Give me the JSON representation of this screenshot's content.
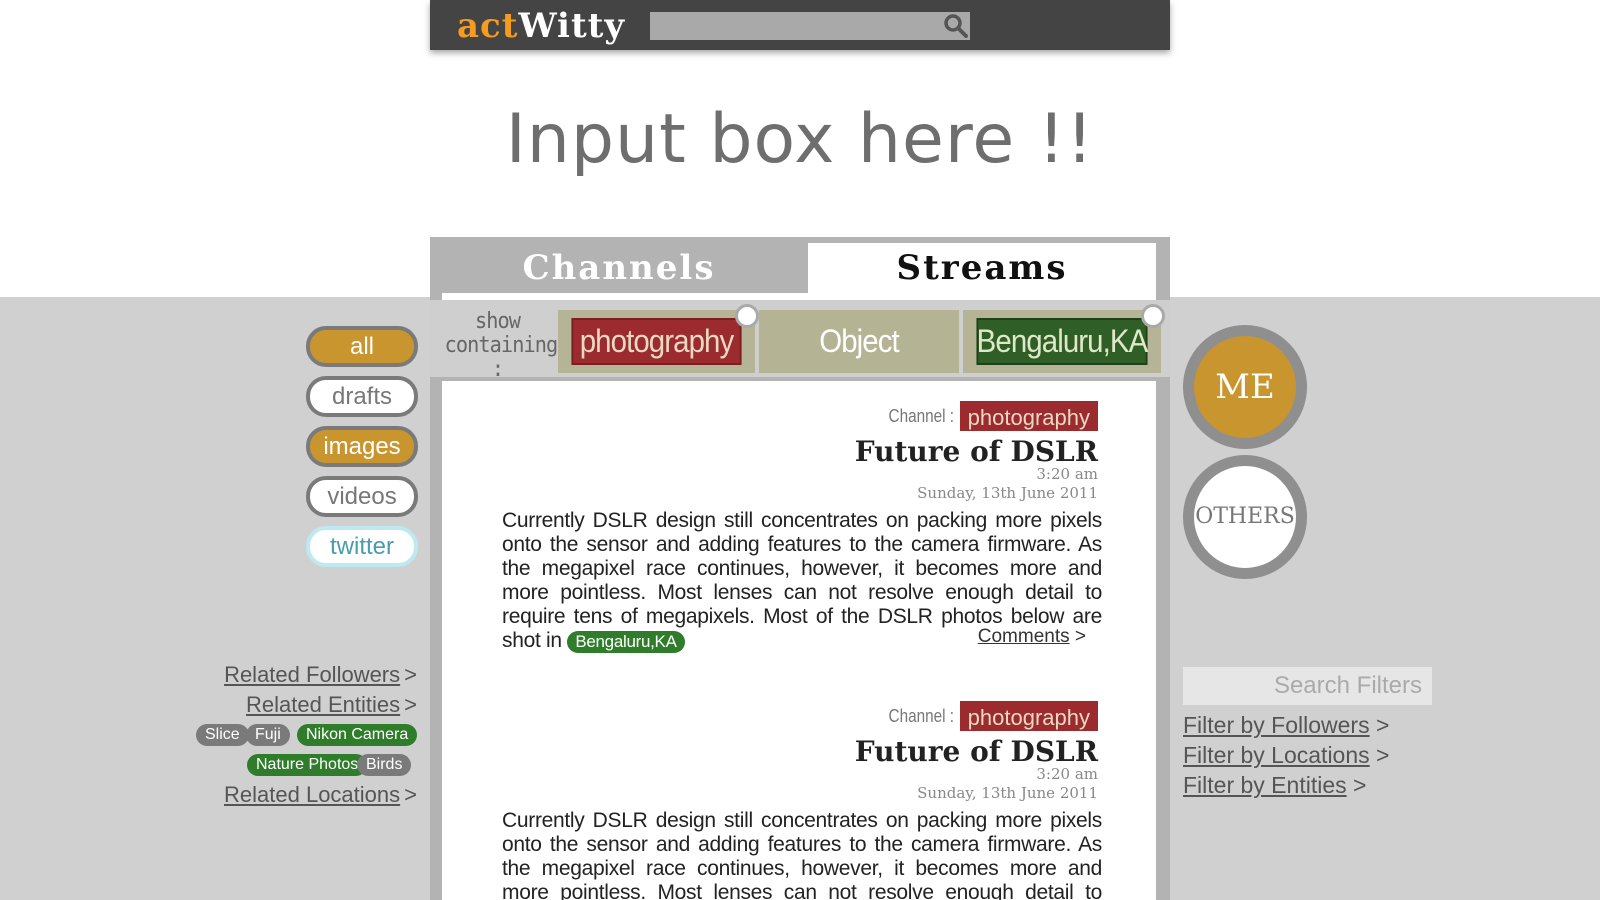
{
  "header": {
    "logo_part1": "act",
    "logo_part2": "Witty",
    "search_placeholder": "",
    "search_icon": "search-icon"
  },
  "headline": "Input box here !!",
  "tabs": [
    {
      "label": "Channels",
      "active": false
    },
    {
      "label": "Streams",
      "active": true
    }
  ],
  "filter_bar": {
    "show_label_line1": "show",
    "show_label_line2": "containing :",
    "chips": [
      {
        "label": "photography",
        "color": "#9c2b30"
      },
      {
        "label": "Object",
        "color": "#b4b495"
      },
      {
        "label": "Bengaluru,KA",
        "color": "#2f5e26"
      }
    ]
  },
  "left_nav": {
    "items": [
      "all",
      "drafts",
      "images",
      "videos",
      "twitter"
    ],
    "related_followers": "Related Followers",
    "related_entities": "Related Entities",
    "related_locations": "Related Locations",
    "arrow": ">",
    "entity_tags": [
      "Slice",
      "Fuji",
      "Nikon Camera",
      "Nature Photos",
      "Birds"
    ]
  },
  "right_nav": {
    "me": "ME",
    "others": "OTHERS",
    "search_placeholder": "Search Filters",
    "filters": [
      "Filter by Followers",
      "Filter by Locations",
      "Filter by Entities"
    ],
    "arrow": ">"
  },
  "posts": [
    {
      "channel_label": "Channel :",
      "channel": "photography",
      "title": "Future of DSLR",
      "time": "3:20 am",
      "date": "Sunday, 13th June 2011",
      "body": "Currently DSLR design still concentrates on packing more pixels onto the sensor and adding features to the camera firmware. As the megapixel race continues, however, it becomes more and more pointless. Most lenses can not resolve enough detail to require tens of megapixels. Most of the DSLR photos below are shot in",
      "location": "Bengaluru,KA",
      "comments": "Comments",
      "arrow": ">"
    },
    {
      "channel_label": "Channel :",
      "channel": "photography",
      "title": "Future of DSLR",
      "time": "3:20 am",
      "date": "Sunday, 13th June 2011",
      "body": "Currently DSLR design still concentrates on packing more pixels onto the sensor and adding features to the camera firmware. As the megapixel race continues, however, it becomes more and more pointless. Most lenses can not resolve enough detail to require tens of megapixels. Most of the DSLR"
    }
  ],
  "colors": {
    "accent_orange": "#c8952f",
    "logo_orange": "#f39c1f",
    "dark_bar": "#444444",
    "band_grey": "#d0d0d0",
    "tag_green": "#2f7d2a",
    "tag_red": "#9c2b30"
  }
}
